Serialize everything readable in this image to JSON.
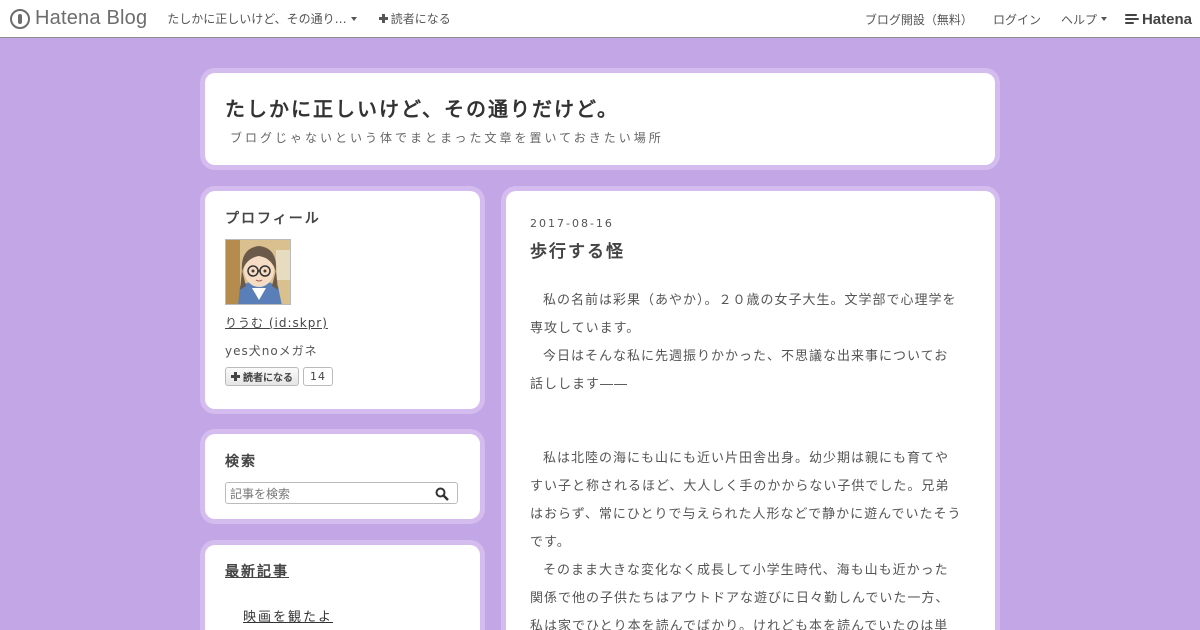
{
  "globalbar": {
    "logo_text": "Hatena Blog",
    "blog_name": "たしかに正しいけど、その通り…",
    "reader_label": "読者になる",
    "start_blog": "ブログ開設（無料）",
    "login": "ログイン",
    "help": "ヘルプ",
    "hatena": "Hatena"
  },
  "header": {
    "title": "たしかに正しいけど、その通りだけど。",
    "description": "ブログじゃないという体でまとまった文章を置いておきたい場所"
  },
  "profile": {
    "heading": "プロフィール",
    "id_link": "りうむ (id:skpr)",
    "description": "yes犬noメガネ",
    "subscribe_label": "読者になる",
    "subscriber_count": "14"
  },
  "search": {
    "heading": "検索",
    "placeholder": "記事を検索"
  },
  "recent": {
    "heading": "最新記事",
    "items": [
      "映画を観たよ"
    ]
  },
  "entry": {
    "date": "2017-08-16",
    "title": "歩行する怪",
    "paragraphs": [
      "私の名前は彩果（あやか）。２０歳の女子大生。文学部で心理学を専攻しています。",
      "今日はそんな私に先週振りかかった、不思議な出来事についてお話しします――",
      "私は北陸の海にも山にも近い片田舎出身。幼少期は親にも育てやすい子と称されるほど、大人しく手のかからない子供でした。兄弟はおらず、常にひとりで与えられた人形などで静かに遊んでいたそうです。",
      "そのまま大きな変化なく成長して小学生時代、海も山も近かった関係で他の子供たちはアウトドアな遊びに日々勤しんでいた一方、私は家でひとり本を読んでばかり。けれども本を読んでいたのは単"
    ]
  }
}
